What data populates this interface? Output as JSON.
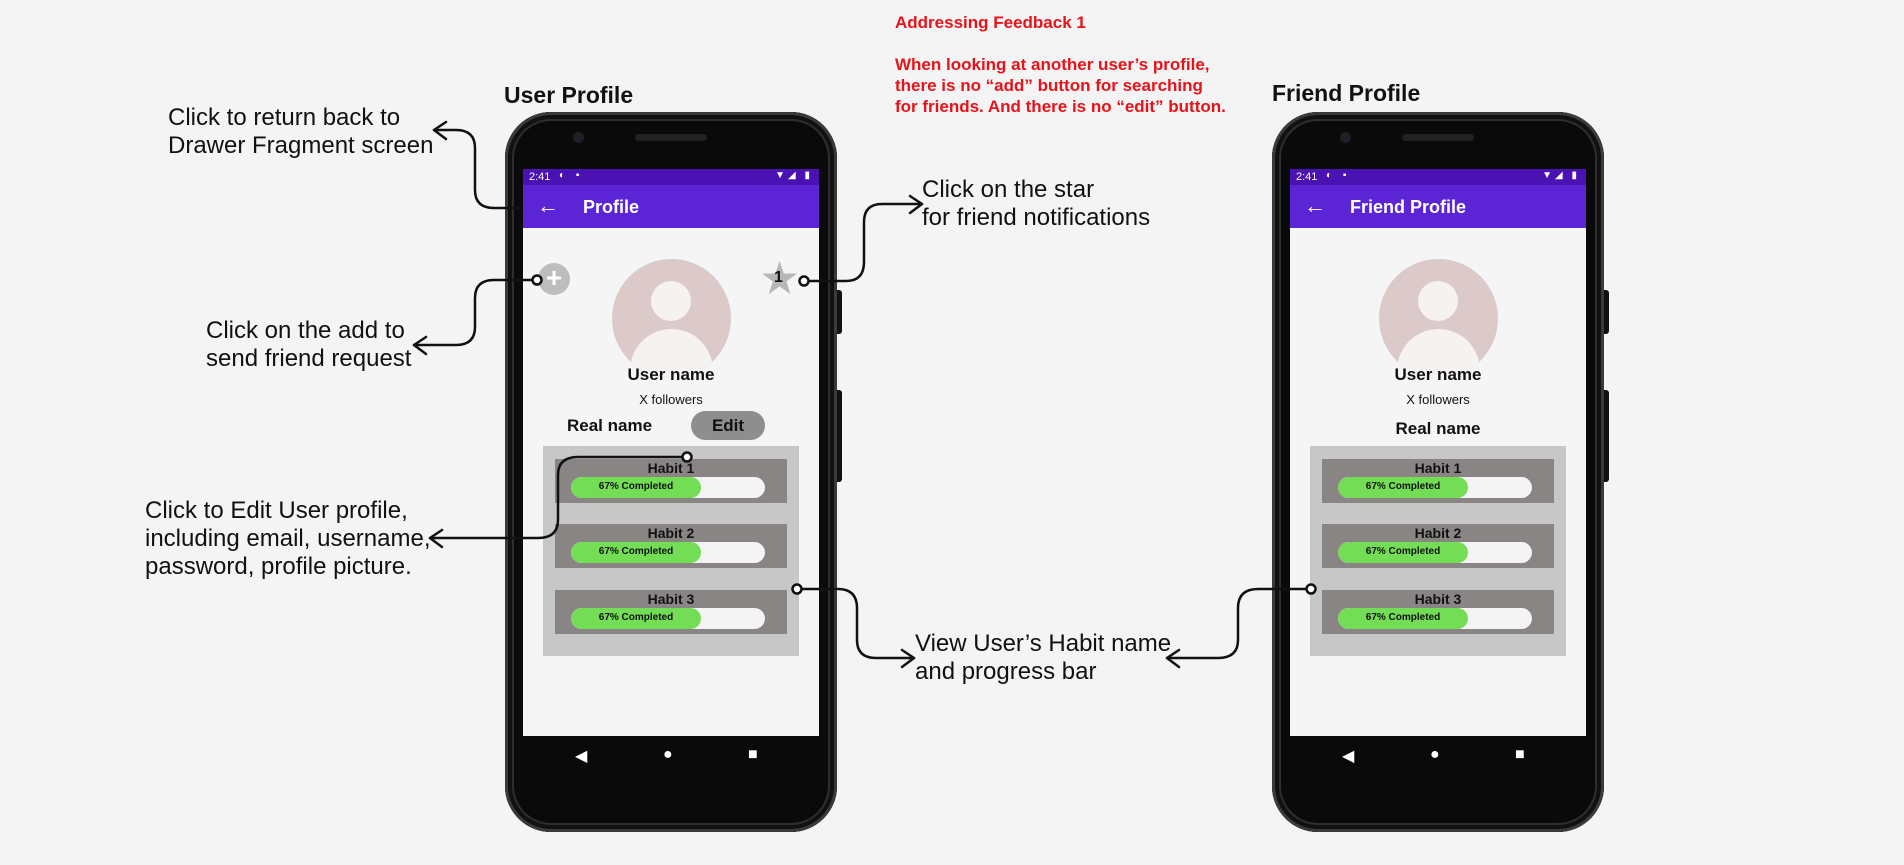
{
  "feedback": {
    "title": "Addressing Feedback 1",
    "lines": [
      "When looking at another user’s profile,",
      "there is no “add” button for searching",
      "for friends. And there is no “edit” button."
    ]
  },
  "frames": {
    "user_profile_title": "User Profile",
    "friend_profile_title": "Friend Profile"
  },
  "annotations": {
    "return": [
      "Click to return back to",
      "Drawer Fragment screen"
    ],
    "add": [
      "Click on the add to",
      "send friend request"
    ],
    "edit": [
      "Click to Edit User profile,",
      "including email, username,",
      "password, profile picture."
    ],
    "star": [
      "Click on the star",
      "for friend notifications"
    ],
    "habits": [
      "View User’s Habit name",
      "and progress bar"
    ]
  },
  "user_screen": {
    "status_time": "2:41",
    "app_title": "Profile",
    "user_name": "User name",
    "followers": "X followers",
    "real_name": "Real name",
    "edit_label": "Edit",
    "star_count": "1",
    "habits": [
      {
        "name": "Habit 1",
        "progress_label": "67% Completed",
        "progress": 0.67
      },
      {
        "name": "Habit 2",
        "progress_label": "67% Completed",
        "progress": 0.67
      },
      {
        "name": "Habit 3",
        "progress_label": "67% Completed",
        "progress": 0.67
      }
    ]
  },
  "friend_screen": {
    "status_time": "2:41",
    "app_title": "Friend Profile",
    "user_name": "User name",
    "followers": "X followers",
    "real_name": "Real name",
    "habits": [
      {
        "name": "Habit 1",
        "progress_label": "67% Completed",
        "progress": 0.67
      },
      {
        "name": "Habit 2",
        "progress_label": "67% Completed",
        "progress": 0.67
      },
      {
        "name": "Habit 3",
        "progress_label": "67% Completed",
        "progress": 0.67
      }
    ]
  },
  "icons": {
    "back": "arrow-left-icon",
    "add": "plus-icon",
    "star": "star-icon",
    "nav_back": "triangle-back-icon",
    "nav_home": "circle-home-icon",
    "nav_recent": "square-recent-icon"
  },
  "colors": {
    "appbar": "#5b25d5",
    "statusbar": "#4a12b3",
    "progress_fill": "#73dd55",
    "feedback_text": "#e8121a"
  }
}
